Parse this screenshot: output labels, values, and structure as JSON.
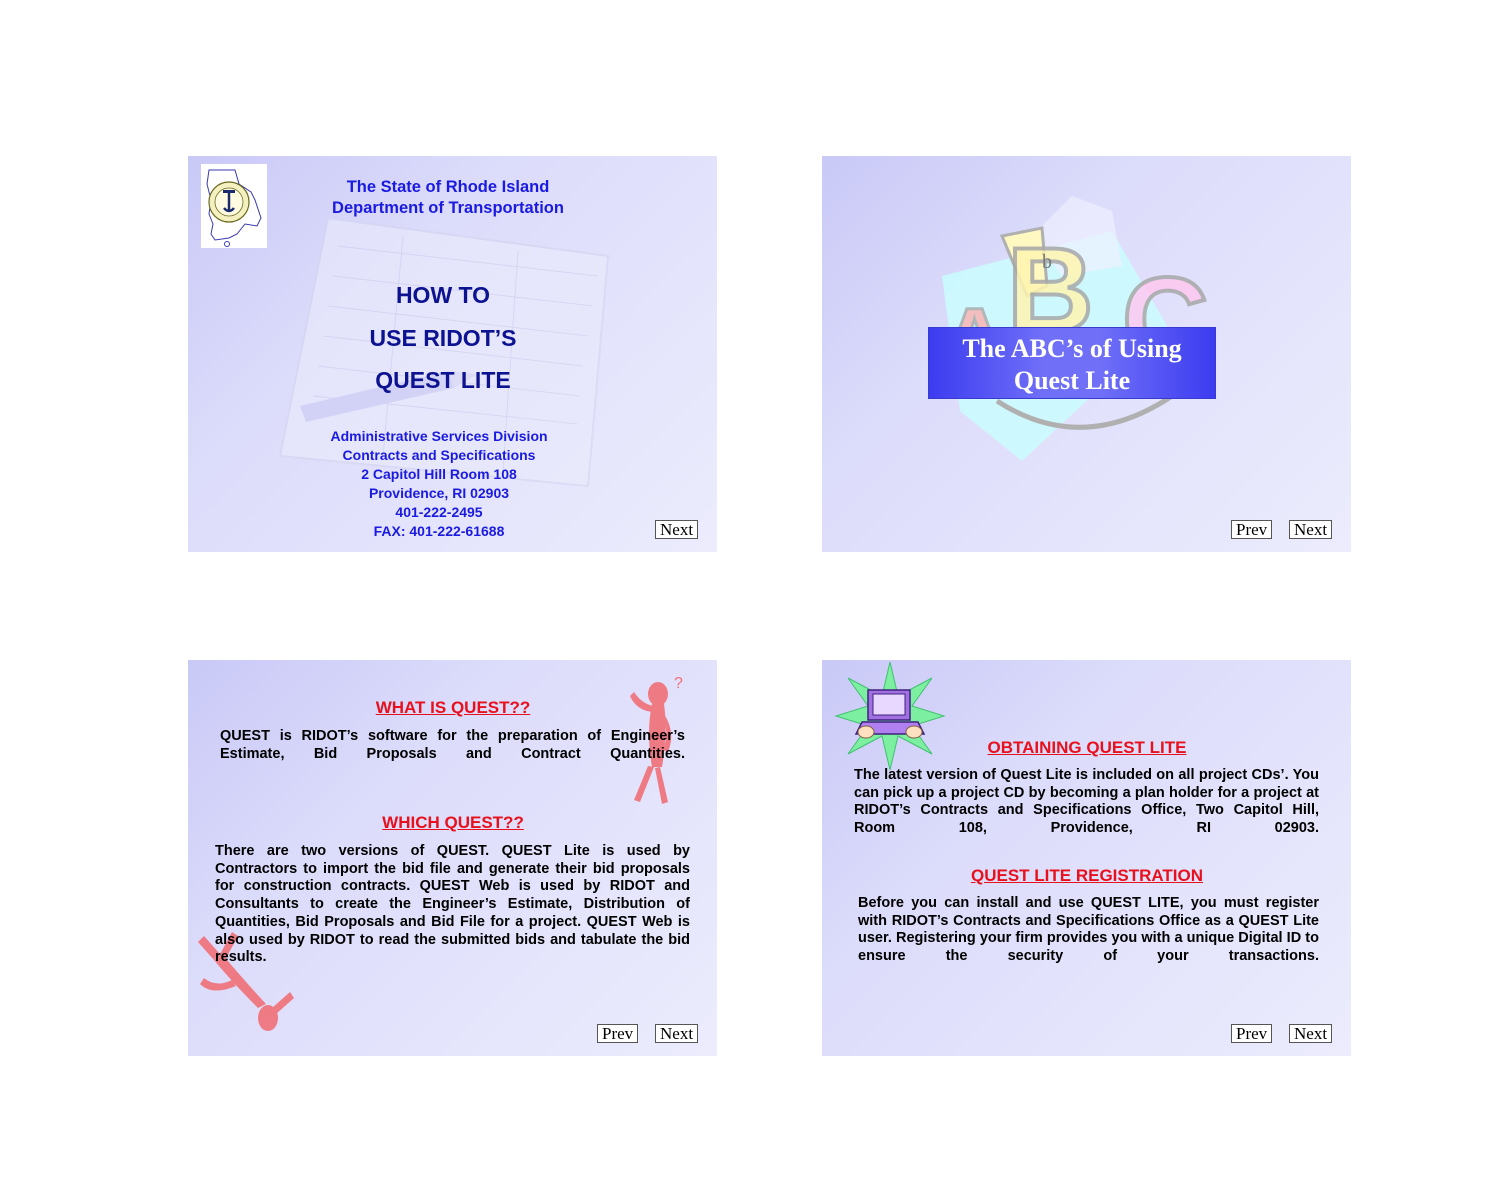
{
  "slide1": {
    "header_line1": "The State of Rhode Island",
    "header_line2": "Department of Transportation",
    "title_line1": "HOW TO",
    "title_line2": "USE RIDOT’S",
    "title_line3": "QUEST LITE",
    "info": [
      "Administrative Services Division",
      "Contracts and Specifications",
      "2 Capitol Hill Room 108",
      "Providence, RI 02903",
      "401-222-2495",
      "FAX: 401-222-61688"
    ],
    "next_label": "Next"
  },
  "slide2": {
    "title_line1": "The ABC’s of Using",
    "title_line2": "Quest Lite",
    "prev_label": "Prev",
    "next_label": "Next"
  },
  "slide3": {
    "heading1": "WHAT IS QUEST??",
    "para1": "QUEST is RIDOT’s software for the preparation of Engineer’s Estimate, Bid Proposals and Contract Quantities.",
    "heading2": "WHICH QUEST??",
    "para2": "There are two versions of QUEST. QUEST Lite is used by Contractors to import the bid file and generate their bid proposals for construction contracts. QUEST Web is used by RIDOT and Consultants to create the Engineer’s Estimate, Distribution of Quantities, Bid Proposals and Bid File for a project. QUEST Web is also used by RIDOT to read the submitted bids and tabulate the bid results.",
    "prev_label": "Prev",
    "next_label": "Next"
  },
  "slide4": {
    "heading1": "OBTAINING QUEST LITE",
    "para1": "The latest version of Quest Lite is included on all project CDs’. You can pick up a project CD by becoming a plan holder for a project at RIDOT’s Contracts and Specifications Office, Two Capitol Hill, Room 108, Providence, RI 02903.",
    "heading2": "QUEST LITE REGISTRATION",
    "para2": "Before you can install and use QUEST LITE, you must register with RIDOT’s Contracts and Specifications Office as a QUEST Lite user.  Registering your firm provides you with a unique Digital ID to ensure the security of your transactions.",
    "prev_label": "Prev",
    "next_label": "Next"
  },
  "colors": {
    "slide_bg": "#dcdcfb",
    "header_blue": "#1a1ae0",
    "title_navy": "#0c1290",
    "heading_red": "#e8101c"
  }
}
